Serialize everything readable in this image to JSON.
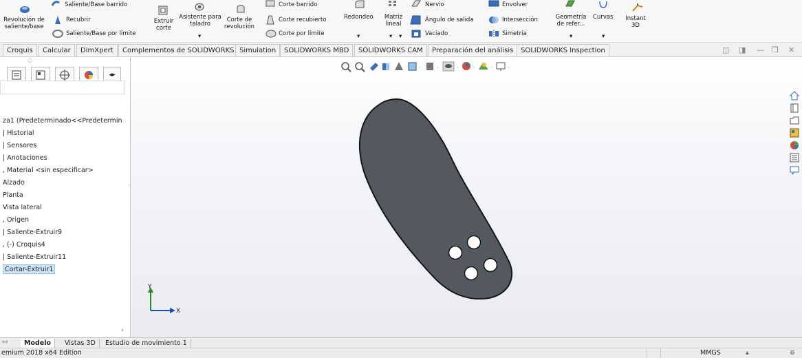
{
  "ribbon": {
    "revolve_label": "Revolución de saliente/base",
    "sweep_boss_label": "Saliente/Base barrido",
    "wrap_label": "Recubrir",
    "loft_boss_label": "Saliente/Base por límite",
    "extrude_cut_label": "Extruir corte",
    "hole_wizard_label": "Asistente para taladro",
    "revolve_cut_label": "Corte de revolución",
    "swept_cut_label": "Corte barrido",
    "lofted_cut_label": "Corte recubierto",
    "boundary_cut_label": "Corte por límite",
    "fillet_label": "Redondeo",
    "linear_pattern_label": "Matriz lineal",
    "rib_label": "Nervio",
    "draft_label": "Ángulo de salida",
    "shell_label": "Vaciado",
    "wrap2_label": "Envolver",
    "intersect_label": "Intersección",
    "mirror_label": "Simetría",
    "ref_geometry_label": "Geometría de refer...",
    "curves_label": "Curvas",
    "instant3d_label": "Instant 3D"
  },
  "command_tabs": [
    "Croquis",
    "Calcular",
    "DimXpert",
    "Complementos de SOLIDWORKS",
    "Simulation",
    "SOLIDWORKS MBD",
    "SOLIDWORKS CAM",
    "Preparación del análisis",
    "SOLIDWORKS Inspection"
  ],
  "tree": {
    "root": "za1 (Predeterminado<<Predetermin",
    "items": [
      "Historial",
      "Sensores",
      "Anotaciones",
      "Material <sin especificar>",
      "Alzado",
      "Planta",
      "Vista lateral",
      "Origen",
      "Saliente-Extruir9",
      "(-) Croquis4",
      "Saliente-Extruir11",
      "Cortar-Extruir1"
    ]
  },
  "bottom_tabs": [
    "Modelo",
    "Vistas 3D",
    "Estudio de movimiento 1"
  ],
  "status": {
    "edition": "emium 2018 x64 Edition",
    "units": "MMGS"
  },
  "triad": {
    "x": "X",
    "y": "Y"
  },
  "colors": {
    "part_fill": "#545960",
    "part_edge": "#151515",
    "select_bg": "#cde6f7"
  }
}
